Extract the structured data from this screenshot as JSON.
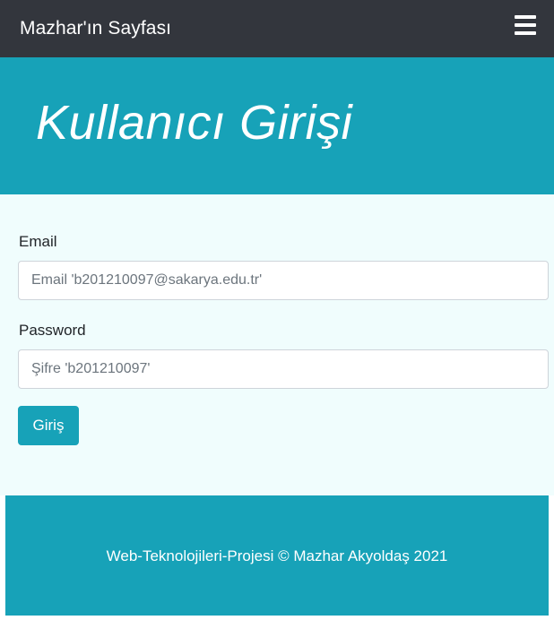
{
  "navbar": {
    "brand": "Mazhar'ın Sayfası",
    "menu_icon": "hamburger-menu-icon",
    "background": "#33363d"
  },
  "hero": {
    "title": "Kullanıcı Girişi",
    "background": "#17a2b8"
  },
  "form": {
    "email_label": "Email",
    "email_placeholder": "Email 'b201210097@sakarya.edu.tr'",
    "email_value": "",
    "password_label": "Password",
    "password_placeholder": "Şifre 'b201210097'",
    "password_value": "",
    "submit_label": "Giriş",
    "background": "#f0fdfd"
  },
  "footer": {
    "text": "Web-Teknolojileri-Projesi © Mazhar Akyoldaş 2021",
    "background": "#17a2b8"
  }
}
